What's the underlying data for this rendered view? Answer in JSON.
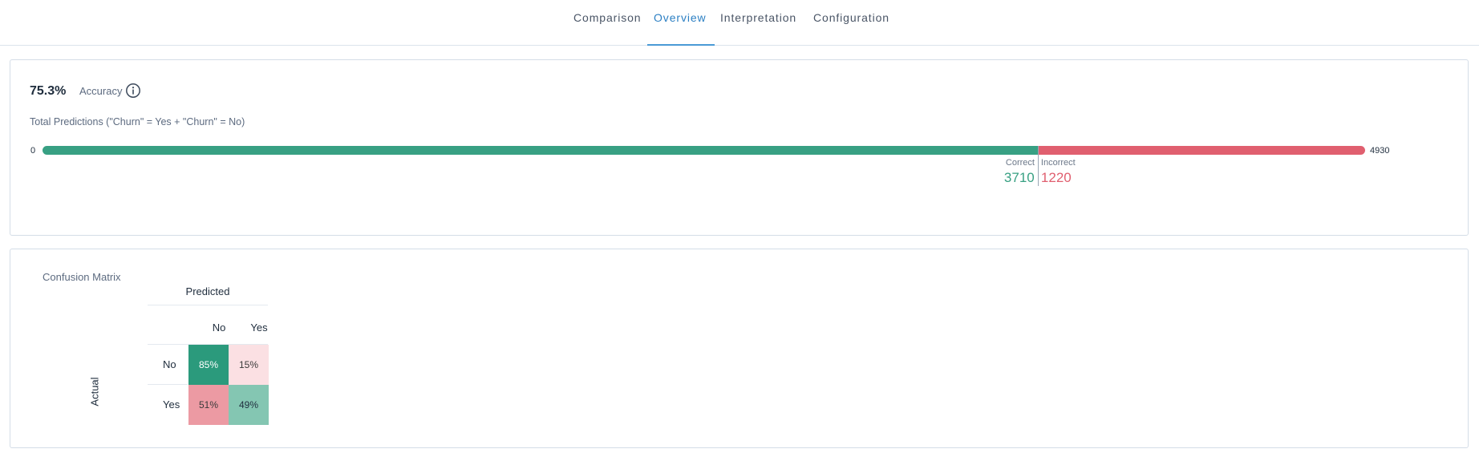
{
  "tabs": [
    {
      "label": "Comparison",
      "active": false
    },
    {
      "label": "Overview",
      "active": true
    },
    {
      "label": "Interpretation",
      "active": false
    },
    {
      "label": "Configuration",
      "active": false
    }
  ],
  "accuracy": {
    "value": "75.3%",
    "label": "Accuracy",
    "info_icon": "info-icon",
    "total_label": "Total Predictions (\"Churn\" = Yes + \"Churn\" = No)",
    "bar": {
      "min_label": "0",
      "max_label": "4930",
      "correct": 3710,
      "incorrect": 1220,
      "total": 4930,
      "correct_label": "Correct",
      "incorrect_label": "Incorrect",
      "correct_value": "3710",
      "incorrect_value": "1220",
      "correct_color": "#38a083",
      "incorrect_color": "#e05f6f"
    }
  },
  "confusion_matrix": {
    "title": "Confusion Matrix",
    "predicted_label": "Predicted",
    "actual_label": "Actual",
    "columns": [
      "No",
      "Yes"
    ],
    "rows": [
      "No",
      "Yes"
    ],
    "cells": [
      [
        {
          "text": "85%",
          "bg": "#2b9a7c",
          "fg": "#ffffff"
        },
        {
          "text": "15%",
          "bg": "#fbe0e3",
          "fg": "#3a3a3a"
        }
      ],
      [
        {
          "text": "51%",
          "bg": "#ec9aa3",
          "fg": "#3a3a3a"
        },
        {
          "text": "49%",
          "bg": "#84c6b2",
          "fg": "#1f2d3d"
        }
      ]
    ]
  }
}
